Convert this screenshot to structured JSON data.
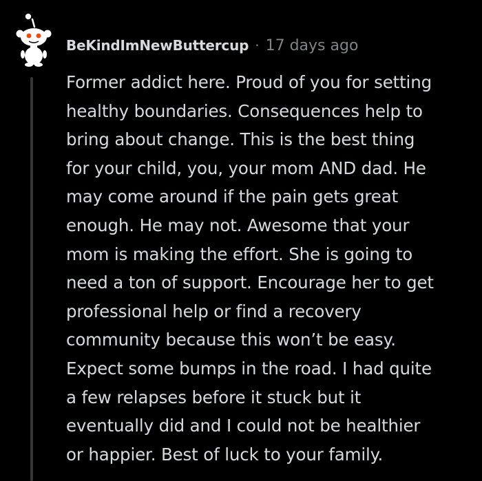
{
  "comment": {
    "author": "BeKindImNewButtercup",
    "separator": "·",
    "timestamp": "17 days ago",
    "body_lines": [
      "Former addict here. Proud of you for setting",
      "healthy boundaries. Consequences help to",
      "bring about change. This is the best thing",
      "for your child, you, your mom AND dad. He",
      "may come around if the pain gets great",
      "enough. He may not. Awesome that your",
      "mom is making the effort. She is going to",
      "need a ton of support. Encourage her to get",
      "professional help or find a recovery",
      "community because this won’t be easy.",
      "Expect some bumps in the road. I had quite",
      "a few relapses before it stuck but it",
      "eventually did and I could not be healthier",
      "or happier. Best of luck to your family."
    ]
  },
  "colors": {
    "background": "#000000",
    "text": "#d7dadc",
    "meta": "#818384",
    "thread_line": "#343536",
    "snoo_eyes": "#ff4500"
  },
  "icons": {
    "avatar": "reddit-snoo-avatar-icon"
  }
}
